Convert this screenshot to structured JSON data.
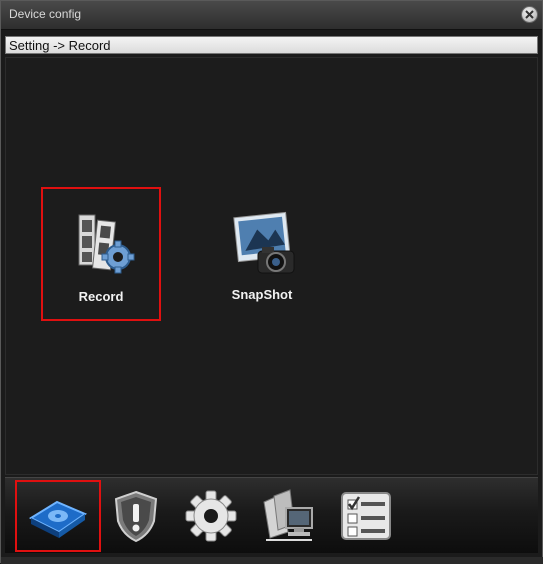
{
  "window": {
    "title": "Device config"
  },
  "breadcrumb": {
    "text": "Setting -> Record"
  },
  "main": {
    "tiles": [
      {
        "label": "Record",
        "icon": "film-gear-icon",
        "selected": true
      },
      {
        "label": "SnapShot",
        "icon": "camera-photo-icon",
        "selected": false
      }
    ]
  },
  "bottom_nav": {
    "items": [
      {
        "icon": "storage-disk-icon",
        "selected": true
      },
      {
        "icon": "alarm-shield-icon",
        "selected": false
      },
      {
        "icon": "settings-gear-icon",
        "selected": false
      },
      {
        "icon": "network-tools-icon",
        "selected": false
      },
      {
        "icon": "checklist-icon",
        "selected": false
      }
    ]
  },
  "colors": {
    "highlight": "#e01010",
    "background": "#1c1c1c"
  }
}
